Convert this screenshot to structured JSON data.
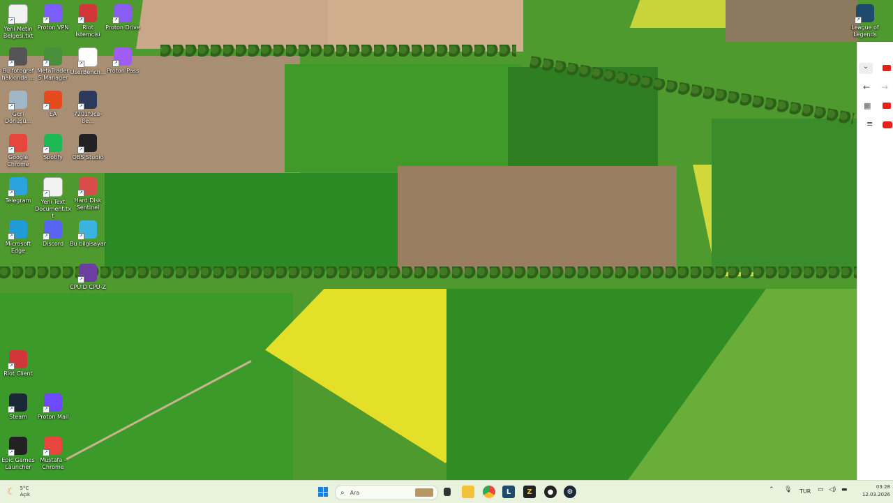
{
  "desktop_icons": [
    {
      "label": "Yeni Metin Belgesi.txt",
      "icon": "text-file-icon",
      "color": "#f2f2f2"
    },
    {
      "label": "Proton VPN",
      "icon": "proton-vpn-icon",
      "color": "#7b5cff"
    },
    {
      "label": "Riot İstemcisi",
      "icon": "riot-client-icon",
      "color": "#d13639"
    },
    {
      "label": "Proton Drive",
      "icon": "proton-drive-icon",
      "color": "#8a5cf6"
    },
    {
      "label": "Bu fotoğraf hakkında ...",
      "icon": "info-circle-icon",
      "color": "#555555"
    },
    {
      "label": "MetaTrader 5 Manager",
      "icon": "metatrader-icon",
      "color": "#4a8f3c"
    },
    {
      "label": "UserBench...",
      "icon": "speedometer-icon",
      "color": "#ffffff"
    },
    {
      "label": "Proton Pass",
      "icon": "proton-pass-icon",
      "color": "#a05cf5"
    },
    {
      "label": "Geri Dönüşü...",
      "icon": "recycle-bin-icon",
      "color": "#9fb7c7"
    },
    {
      "label": "EA",
      "icon": "ea-icon",
      "color": "#e44a1c"
    },
    {
      "label": "7201f9ca-8e...",
      "icon": "image-file-icon",
      "color": "#2b3a5a"
    },
    {
      "label": "Google Chrome",
      "icon": "chrome-icon",
      "color": "#e8453c"
    },
    {
      "label": "Spotify",
      "icon": "spotify-icon",
      "color": "#1db954"
    },
    {
      "label": "OBS Studio",
      "icon": "obs-icon",
      "color": "#222222"
    },
    {
      "label": "Telegram",
      "icon": "telegram-icon",
      "color": "#2aa3df"
    },
    {
      "label": "Yeni Text Document.txt",
      "icon": "text-file-icon",
      "color": "#f2f2f2"
    },
    {
      "label": "Hard Disk Sentinel",
      "icon": "hard-disk-icon",
      "color": "#d94c4c"
    },
    {
      "label": "Microsoft Edge",
      "icon": "edge-icon",
      "color": "#1f9bd6"
    },
    {
      "label": "Discord",
      "icon": "discord-icon",
      "color": "#5865f2"
    },
    {
      "label": "Bu bilgisayar",
      "icon": "computer-icon",
      "color": "#3bb3e0"
    },
    {
      "label": "CPUID CPU-Z",
      "icon": "cpuz-icon",
      "color": "#6b3fa0"
    },
    {
      "label": "Riot Client",
      "icon": "riot-client-icon",
      "color": "#d13639"
    },
    {
      "label": "Steam",
      "icon": "steam-icon",
      "color": "#1b2838"
    },
    {
      "label": "Proton Mail",
      "icon": "proton-mail-icon",
      "color": "#6d4aff"
    },
    {
      "label": "Epic Games Launcher",
      "icon": "epic-games-icon",
      "color": "#222222"
    },
    {
      "label": "Mustafa - Chrome",
      "icon": "chrome-profile-icon",
      "color": "#e8453c"
    },
    {
      "label": "League of Legends",
      "icon": "league-icon",
      "color": "#1e4a6b"
    }
  ],
  "taskbar": {
    "weather_temp": "5°C",
    "weather_desc": "Açık",
    "search_placeholder": "Ara",
    "language": "TUR",
    "time": "03:28",
    "date": "12.03.2026"
  },
  "browser_strip": {
    "icons": [
      "chevron-down-icon",
      "back-arrow-icon",
      "forward-arrow-icon",
      "grid-icon",
      "hamburger-menu-icon",
      "youtube-icon"
    ]
  }
}
